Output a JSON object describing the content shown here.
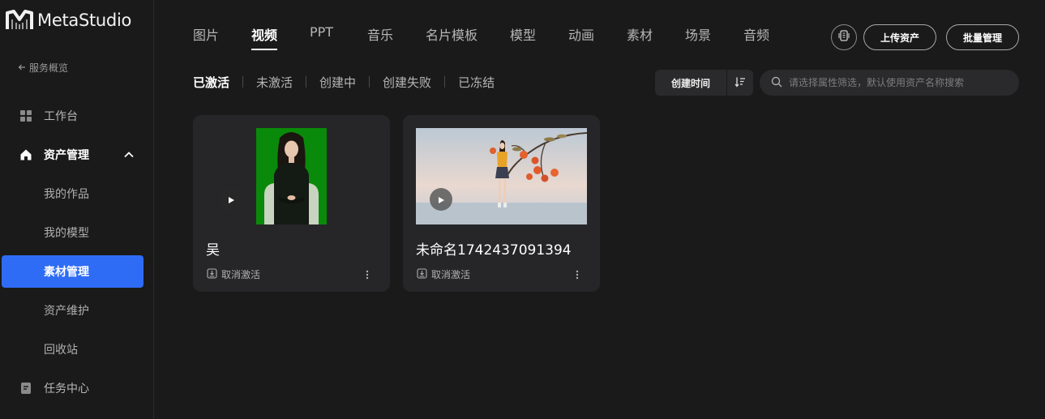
{
  "app": {
    "name": "MetaStudio"
  },
  "sidebar": {
    "back_label": "服务概览",
    "items": [
      {
        "label": "工作台",
        "icon": "dashboard-icon"
      },
      {
        "label": "资产管理",
        "icon": "home-icon",
        "expanded": true
      },
      {
        "label": "我的作品"
      },
      {
        "label": "我的模型"
      },
      {
        "label": "素材管理",
        "active": true
      },
      {
        "label": "资产维护"
      },
      {
        "label": "回收站"
      },
      {
        "label": "任务中心",
        "icon": "task-icon"
      }
    ]
  },
  "tabs": [
    {
      "label": "图片"
    },
    {
      "label": "视频",
      "active": true
    },
    {
      "label": "PPT"
    },
    {
      "label": "音乐"
    },
    {
      "label": "名片模板"
    },
    {
      "label": "模型"
    },
    {
      "label": "动画"
    },
    {
      "label": "素材"
    },
    {
      "label": "场景"
    },
    {
      "label": "音频"
    }
  ],
  "toolbar": {
    "upload_label": "上传资产",
    "batch_label": "批量管理"
  },
  "filters": [
    {
      "label": "已激活",
      "active": true
    },
    {
      "label": "未激活"
    },
    {
      "label": "创建中"
    },
    {
      "label": "创建失败"
    },
    {
      "label": "已冻结"
    }
  ],
  "sort": {
    "label": "创建时间"
  },
  "search": {
    "placeholder": "请选择属性筛选，默认使用资产名称搜索",
    "value": ""
  },
  "cards": [
    {
      "title": "吴",
      "action_label": "取消激活",
      "background": "green-screen"
    },
    {
      "title": "未命名1742437091394",
      "action_label": "取消激活",
      "background": "persimmon-scene"
    }
  ],
  "colors": {
    "accent": "#2f6cf6",
    "background": "#1a1a1b",
    "card": "#262628",
    "green_screen": "#0a8a0a"
  }
}
